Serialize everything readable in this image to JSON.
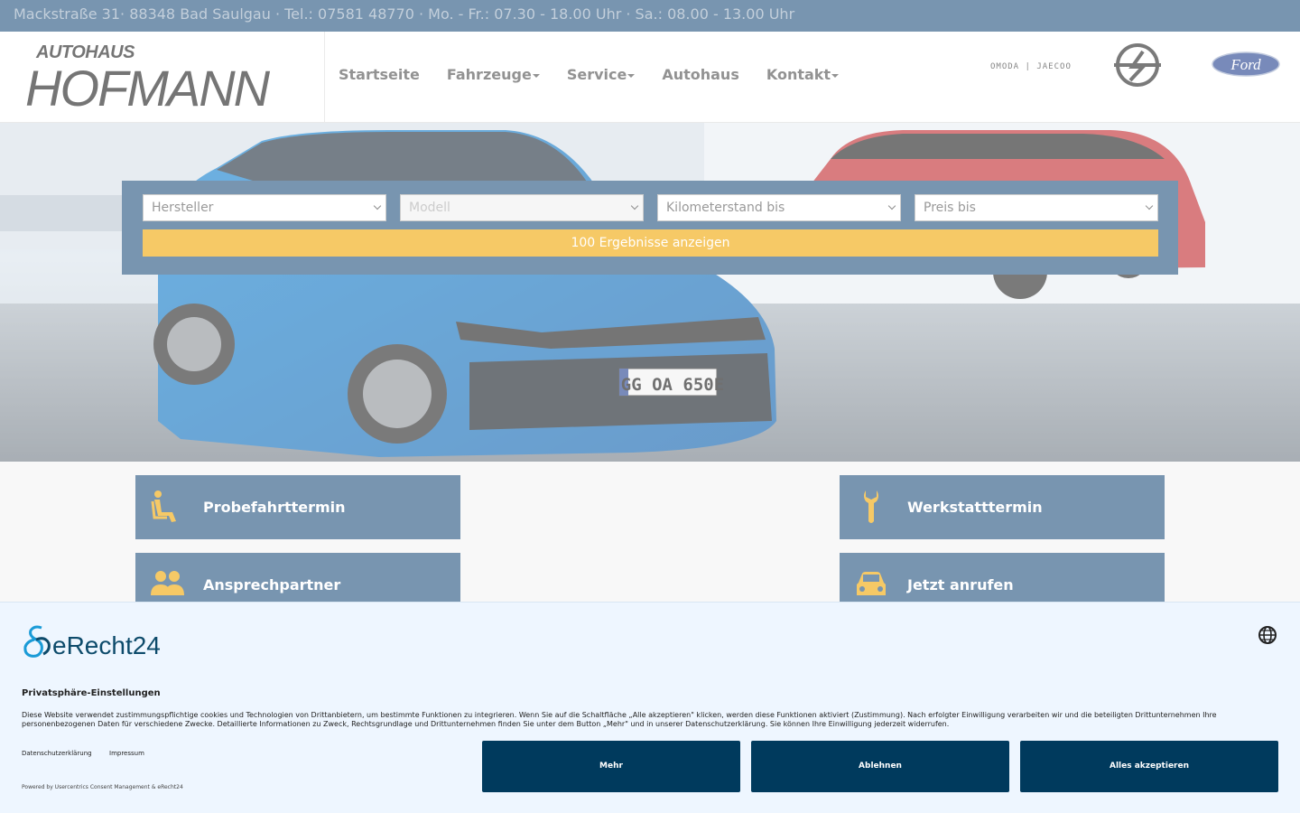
{
  "topbar": {
    "text": "Mackstraße 31· 88348 Bad Saulgau · Tel.: 07581 48770 · Mo. - Fr.: 07.30 - 18.00 Uhr · Sa.: 08.00 - 13.00 Uhr"
  },
  "logo": {
    "line1": "AUTOHAUS",
    "line2": "HOFMANN"
  },
  "nav": {
    "items": [
      {
        "label": "Startseite",
        "dropdown": false
      },
      {
        "label": "Fahrzeuge",
        "dropdown": true
      },
      {
        "label": "Service",
        "dropdown": true
      },
      {
        "label": "Autohaus",
        "dropdown": false
      },
      {
        "label": "Kontakt",
        "dropdown": true
      }
    ]
  },
  "brands": {
    "omoda": "OMODA | JAECOO",
    "ford": "Ford"
  },
  "hero": {
    "plate": "GG OA 650E"
  },
  "search": {
    "manufacturer": "Hersteller",
    "model": "Modell",
    "mileage": "Kilometerstand bis",
    "price": "Preis bis",
    "results_button": "100 Ergebnisse anzeigen"
  },
  "tiles": {
    "test_drive": "Probefahrttermin",
    "workshop": "Werkstatttermin",
    "contact": "Ansprechpartner",
    "call": "Jetzt anrufen"
  },
  "consent": {
    "brand": "eRecht24",
    "title": "Privatsphäre-Einstellungen",
    "text": "Diese Website verwendet zustimmungspflichtige cookies und Technologien von Drittanbietern, um bestimmte Funktionen zu integrieren. Wenn Sie auf die Schaltfläche „Alle akzeptieren\" klicken, werden diese Funktionen aktiviert (Zustimmung). Nach erfolgter Einwilligung verarbeiten wir und die beteiligten Drittunternehmen Ihre personenbezogenen Daten für verschiedene Zwecke. Detaillierte Informationen zu Zweck, Rechtsgrundlage und Drittunternehmen finden Sie unter dem Button „Mehr\" und in unserer Datenschutzerklärung. Sie können Ihre Einwilligung jederzeit widerrufen.",
    "privacy_link": "Datenschutzerklärung",
    "imprint_link": "Impressum",
    "powered": "Powered by Usercentrics Consent Management & eRecht24",
    "more_button": "Mehr",
    "decline_button": "Ablehnen",
    "accept_button": "Alles akzeptieren"
  },
  "colors": {
    "primary": "#1f4f7c",
    "accent": "#f0a500",
    "consent_button": "#003a5d"
  }
}
